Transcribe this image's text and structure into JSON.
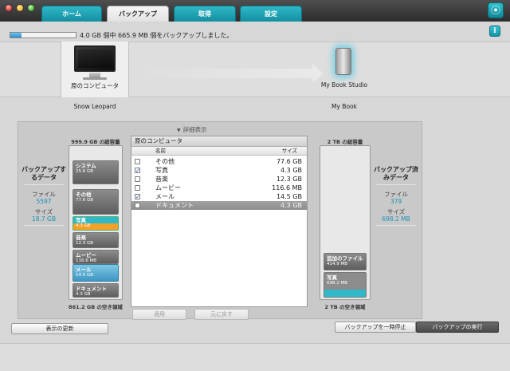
{
  "tabs": [
    {
      "label": "ホーム"
    },
    {
      "label": "バックアップ"
    },
    {
      "label": "取得"
    },
    {
      "label": "設定"
    }
  ],
  "info_icon": "i",
  "progress": {
    "fraction": 0.165,
    "status": "4.0 GB 個中 665.9 MB 個をバックアップしました。"
  },
  "devices": {
    "source": {
      "caption": "原のコンピュータ",
      "name": "Snow Leopard"
    },
    "destination": {
      "caption": "My Book Studio",
      "name": "My Book"
    }
  },
  "detail_toggle": "詳細表示",
  "left_stats": {
    "title": "バックアップするデータ",
    "files_label": "ファイル",
    "files_value": "5597",
    "size_label": "サイズ",
    "size_value": "18.7 GB"
  },
  "right_stats": {
    "title": "バックアップ済みデータ",
    "files_label": "ファイル",
    "files_value": "379",
    "size_label": "サイズ",
    "size_value": "698.2 MB"
  },
  "left_capacity": {
    "total": "999.9 GB の総容量",
    "free": "861.2 GB の空き領域",
    "segments": [
      {
        "name": "システム",
        "size": "25.6 GB"
      },
      {
        "name": "その他",
        "size": "77.6 GB"
      },
      {
        "name": "写真",
        "size": "4.3 GB"
      },
      {
        "name": "音楽",
        "size": "12.3 GB"
      },
      {
        "name": "ムービー",
        "size": "116.6 MB"
      },
      {
        "name": "メール",
        "size": "14.5 GB"
      },
      {
        "name": "ドキュメント",
        "size": "4.3 GB"
      }
    ]
  },
  "right_capacity": {
    "total": "2 TB の総容量",
    "free": "2 TB の空き領域",
    "segments": [
      {
        "name": "追加のファイル",
        "size": "414.9 MB"
      },
      {
        "name": "写真",
        "size": "698.2 MB"
      }
    ]
  },
  "file_list": {
    "title": "原のコンピュータ",
    "col_name": "名前",
    "col_size": "サイズ",
    "rows": [
      {
        "name": "その他",
        "size": "77.6 GB",
        "checked": false
      },
      {
        "name": "写真",
        "size": "4.3 GB",
        "checked": true
      },
      {
        "name": "音楽",
        "size": "12.3 GB",
        "checked": false
      },
      {
        "name": "ムービー",
        "size": "116.6 MB",
        "checked": false
      },
      {
        "name": "メール",
        "size": "14.5 GB",
        "checked": true
      },
      {
        "name": "ドキュメント",
        "size": "4.3 GB",
        "checked": false
      }
    ]
  },
  "buttons": {
    "apply": "適用",
    "revert": "元に戻す",
    "refresh": "表示の更新",
    "pause": "バックアップを一時停止",
    "run": "バックアップの実行"
  }
}
